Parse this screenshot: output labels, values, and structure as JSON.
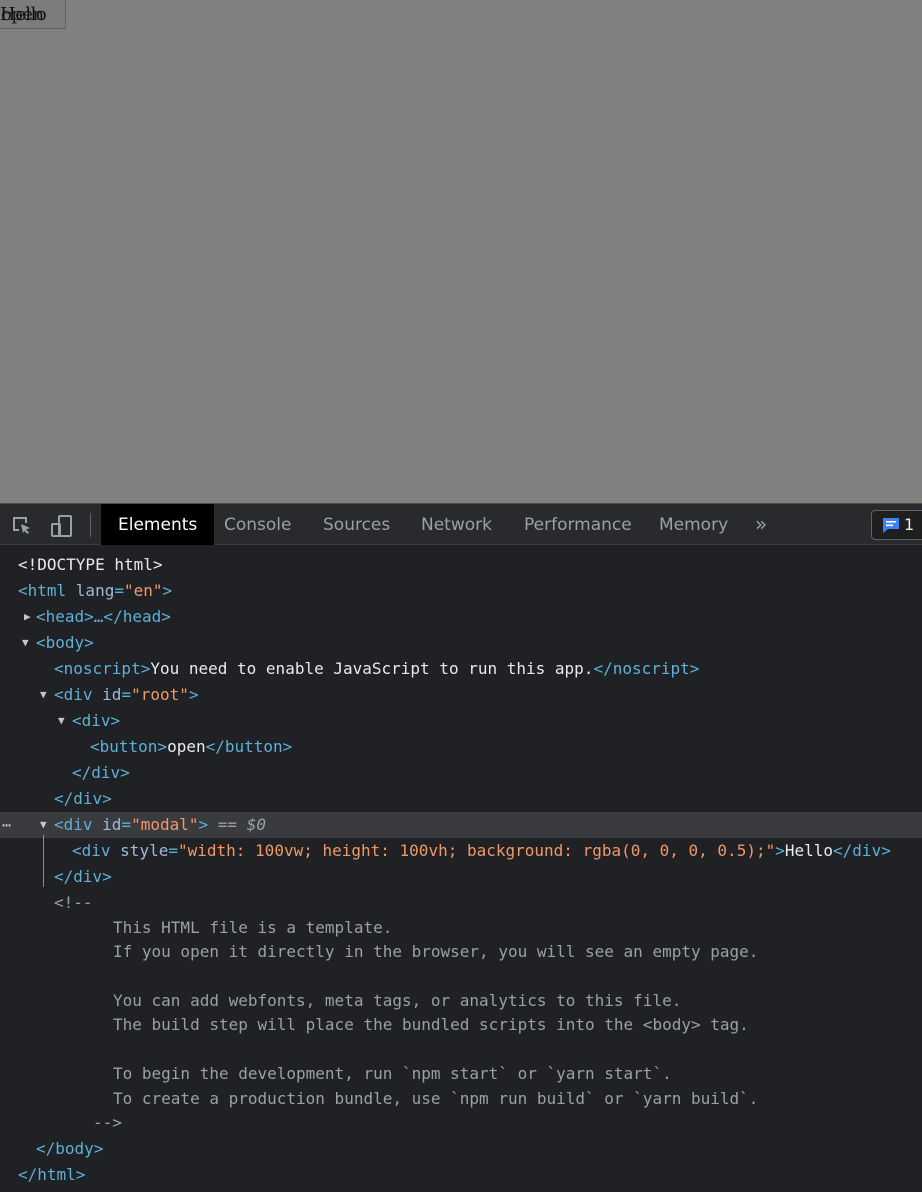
{
  "viewport": {
    "button_label": "open",
    "modal_text": "Hello"
  },
  "devtools": {
    "tabs": [
      {
        "label": "Elements",
        "active": true
      },
      {
        "label": "Console",
        "active": false
      },
      {
        "label": "Sources",
        "active": false
      },
      {
        "label": "Network",
        "active": false
      },
      {
        "label": "Performance",
        "active": false
      },
      {
        "label": "Memory",
        "active": false
      }
    ],
    "more_tabs_glyph": "»",
    "issues_count": "1",
    "icons": [
      "inspect-element-icon",
      "device-toolbar-icon",
      "issues-chat-icon"
    ],
    "tree": {
      "doctype": "<!DOCTYPE html>",
      "html_open": "<html ",
      "html_attr": "lang",
      "html_val": "\"en\"",
      "head": "<head>…</head>",
      "body_open": "<body>",
      "noscript_open": "<noscript>",
      "noscript_text": "You need to enable JavaScript to run this app.",
      "noscript_close": "</noscript>",
      "div_root_open": "<div ",
      "div_root_attr": "id",
      "div_root_val": "\"root\"",
      "div_open": "<div>",
      "button_open": "<button>",
      "button_text": "open",
      "button_close": "</button>",
      "div_close": "</div>",
      "div_modal_attr": "id",
      "div_modal_val": "\"modal\"",
      "selected_marker": "== $0",
      "inner_div_attr": "style",
      "inner_div_val": "\"width: 100vw; height: 100vh; background: rgba(0, 0, 0, 0.5);\"",
      "inner_div_text": "Hello",
      "comment_open": "<!--",
      "comment_lines": [
        "This HTML file is a template.",
        "If you open it directly in the browser, you will see an empty page.",
        "You can add webfonts, meta tags, or analytics to this file.",
        "The build step will place the bundled scripts into the <body> tag.",
        "To begin the development, run `npm start` or `yarn start`.",
        "To create a production bundle, use `npm run build` or `yarn build`."
      ],
      "comment_close": "-->",
      "body_close": "</body>",
      "html_close": "</html>"
    }
  },
  "colors": {
    "viewport_overlay": "#808080",
    "devtools_bg": "#202124",
    "tag": "#5db0d7",
    "attr_value": "#f29766",
    "selected_row": "#3a3b3e",
    "badge_icon": "#3b82f6"
  }
}
